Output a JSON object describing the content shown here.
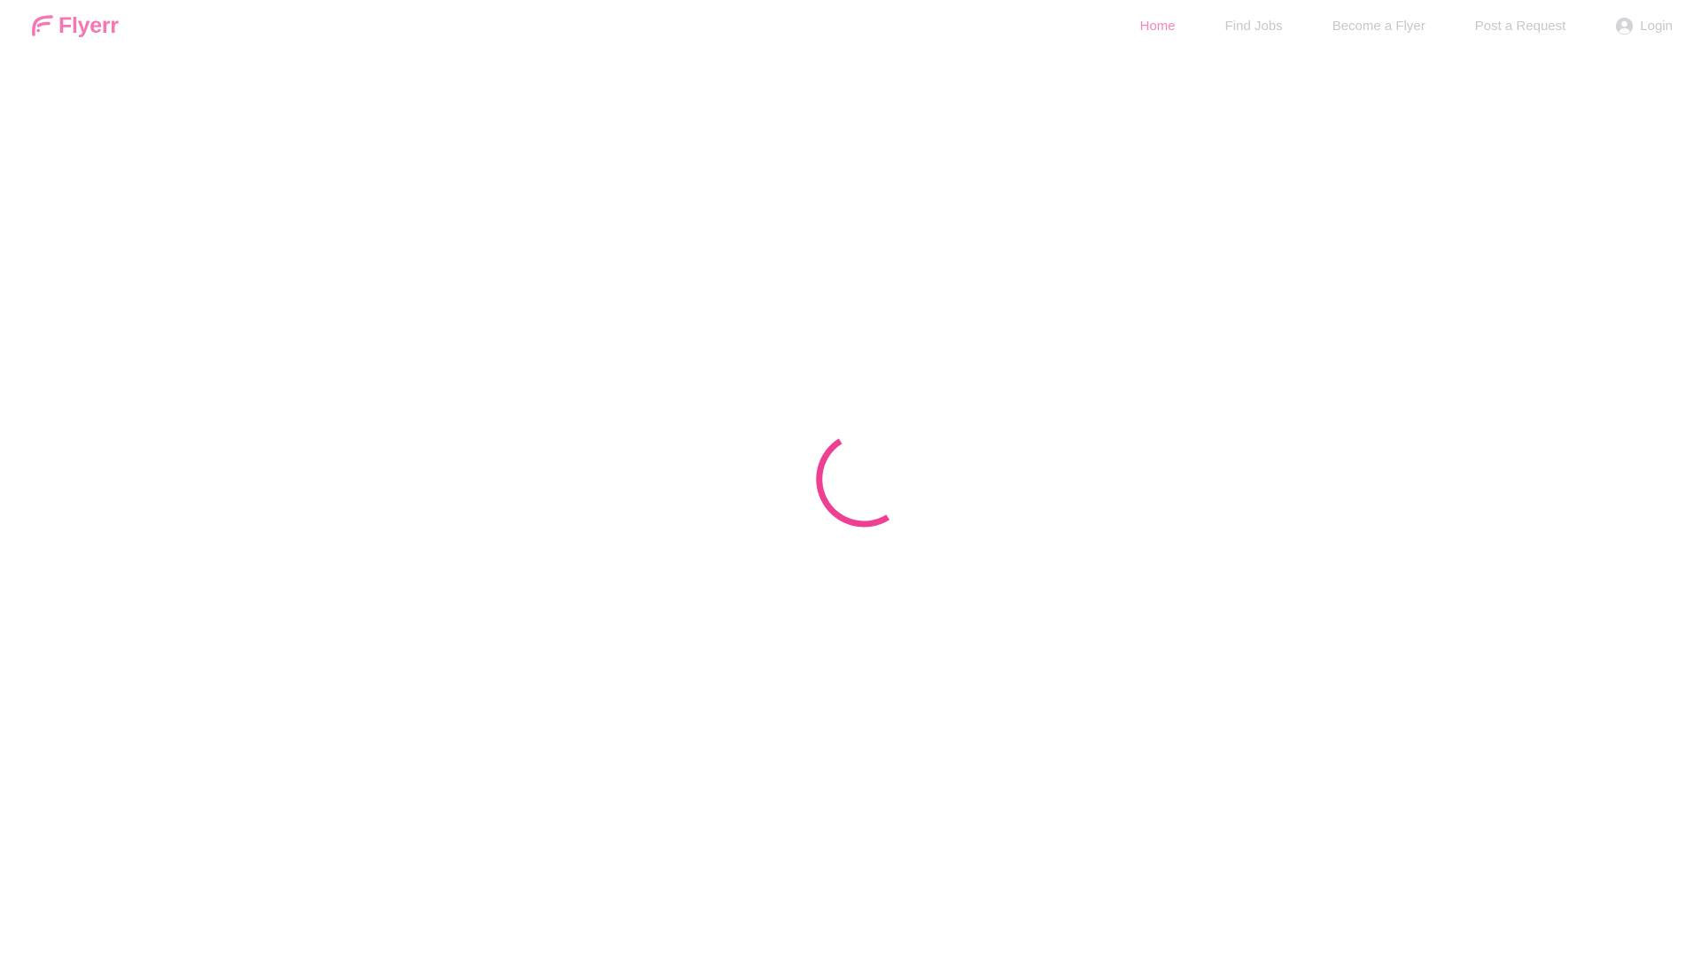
{
  "brand": {
    "name": "Flyerr",
    "logo_icon": "flyerr-f-logo-icon",
    "color": "#f476b4"
  },
  "nav": {
    "items": [
      {
        "label": "Home",
        "active": true
      },
      {
        "label": "Find Jobs",
        "active": false
      },
      {
        "label": "Become a Flyer",
        "active": false
      },
      {
        "label": "Post a Request",
        "active": false
      }
    ],
    "login": {
      "label": "Login",
      "icon": "user-circle-icon"
    }
  },
  "colors": {
    "accent": "#ef3f92",
    "active_nav": "#f487ba",
    "inactive_nav": "#c7c7cc"
  },
  "loading": {
    "icon": "loading-spinner-icon"
  }
}
